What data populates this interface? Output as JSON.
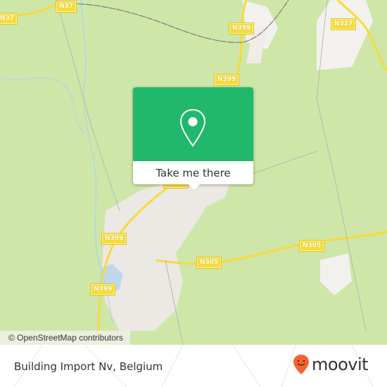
{
  "map": {
    "road_labels": [
      {
        "id": "n37-a",
        "text": "N37"
      },
      {
        "id": "n37-b",
        "text": "N37"
      },
      {
        "id": "n399-a",
        "text": "N399"
      },
      {
        "id": "n327",
        "text": "N327"
      },
      {
        "id": "n399-b",
        "text": "N399"
      },
      {
        "id": "n399-c",
        "text": "N399"
      },
      {
        "id": "n305-a",
        "text": "N305"
      },
      {
        "id": "n305-b",
        "text": "N305"
      },
      {
        "id": "n399-d",
        "text": "N399"
      },
      {
        "id": "n399-e",
        "text": "N399"
      }
    ],
    "attribution": "© OpenStreetMap contributors",
    "colors": {
      "land": "#cfe6a9",
      "urban": "#ece8e3",
      "road": "#f5dc3a",
      "water": "#a8d4f0",
      "rail": "#7a7a7a"
    }
  },
  "popup": {
    "icon": "map-pin-icon",
    "button_label": "Take me there",
    "accent_color": "#21b86c"
  },
  "footer": {
    "place_name": "Building Import Nv, Belgium",
    "brand": "moovit",
    "brand_icon": "moovit-smile-pin-icon",
    "brand_color": "#f26430"
  }
}
